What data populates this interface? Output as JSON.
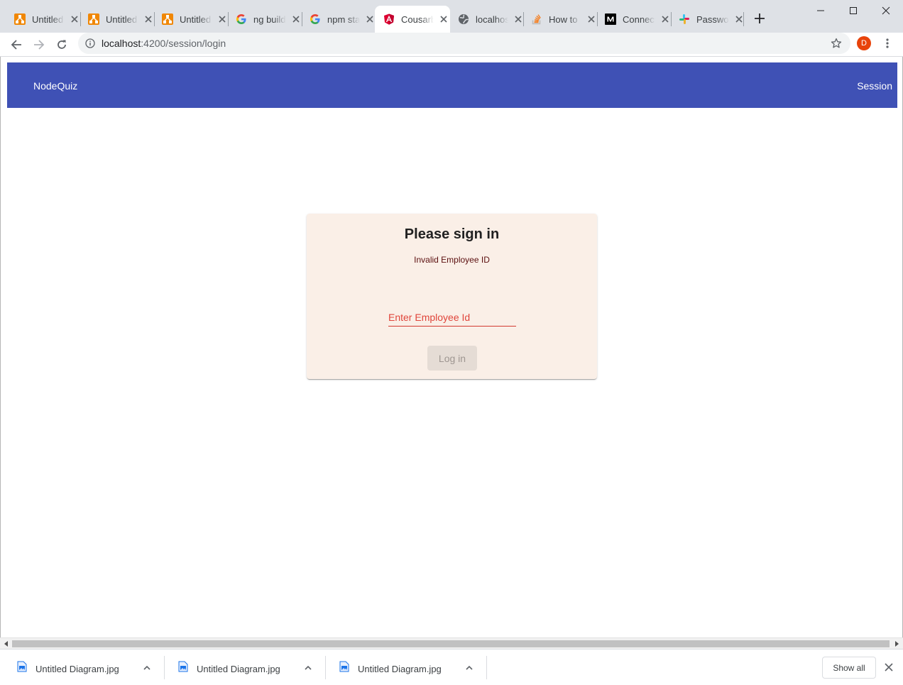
{
  "browser": {
    "tabs": [
      {
        "title": "Untitled Diagram",
        "icon": "drawio-icon"
      },
      {
        "title": "Untitled Diagram",
        "icon": "drawio-icon"
      },
      {
        "title": "Untitled Diagram",
        "icon": "drawio-icon"
      },
      {
        "title": "ng build",
        "icon": "google-icon"
      },
      {
        "title": "npm start",
        "icon": "google-icon"
      },
      {
        "title": "Cousarb",
        "icon": "angular-icon",
        "active": true
      },
      {
        "title": "localhost",
        "icon": "globe-icon"
      },
      {
        "title": "How to",
        "icon": "stackoverflow-icon"
      },
      {
        "title": "Connect",
        "icon": "medium-icon"
      },
      {
        "title": "Password",
        "icon": "slack-icon"
      }
    ],
    "url_host": "localhost",
    "url_path": ":4200/session/login",
    "profile_initial": "D"
  },
  "app": {
    "brand": "NodeQuiz",
    "nav_session": "Session",
    "accent_color": "#3f51b5"
  },
  "login": {
    "title": "Please sign in",
    "error": "Invalid Employee ID",
    "field_label": "Enter Employee Id",
    "button": "Log in",
    "error_color": "#e0453b"
  },
  "downloads": {
    "items": [
      {
        "name": "Untitled Diagram.jpg"
      },
      {
        "name": "Untitled Diagram.jpg"
      },
      {
        "name": "Untitled Diagram.jpg"
      }
    ],
    "show_all": "Show all"
  }
}
